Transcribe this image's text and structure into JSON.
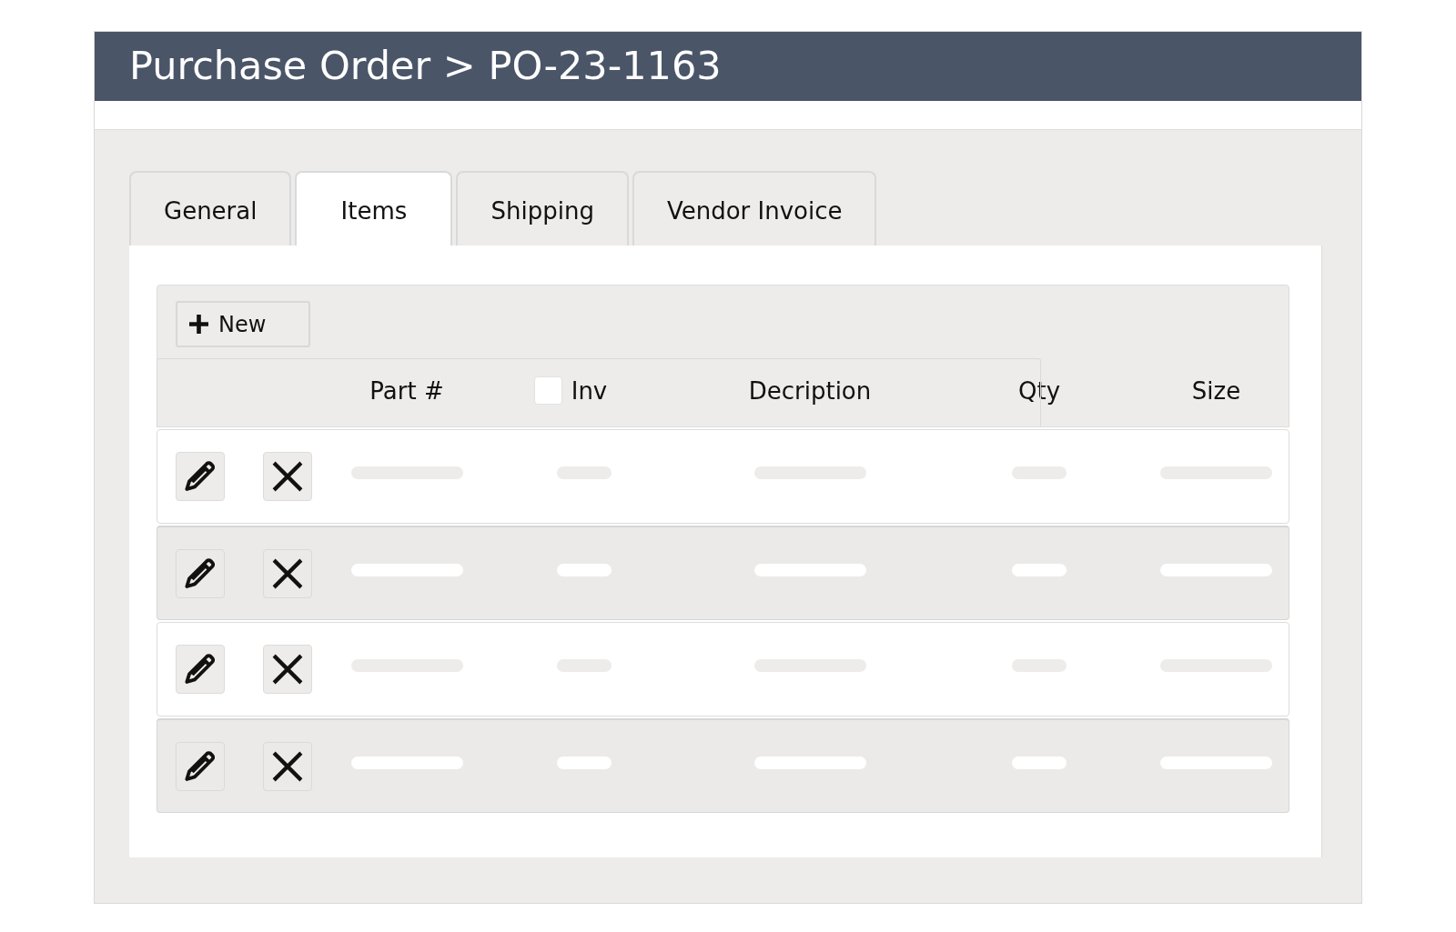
{
  "window": {
    "title": "Purchase Order > PO-23-1163"
  },
  "tabs": [
    {
      "label": "General",
      "selected": false
    },
    {
      "label": "Items",
      "selected": true
    },
    {
      "label": "Shipping",
      "selected": false
    },
    {
      "label": "Vendor Invoice",
      "selected": false
    }
  ],
  "toolbar": {
    "new_button": "New"
  },
  "table": {
    "columns": [
      {
        "label": "Part #"
      },
      {
        "label": "Inv",
        "checkbox": {
          "checked": false
        }
      },
      {
        "label": "Decription"
      },
      {
        "label": "Qty"
      },
      {
        "label": "Size"
      }
    ],
    "rows": [
      {
        "shaded": false
      },
      {
        "shaded": true
      },
      {
        "shaded": false
      },
      {
        "shaded": true
      }
    ]
  }
}
